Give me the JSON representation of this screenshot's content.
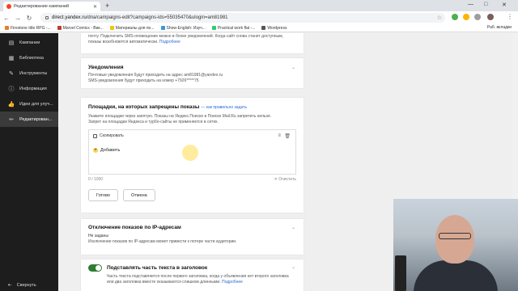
{
  "browser": {
    "tab_title": "Редактирование кампаний",
    "url_domain": "direct.yandex.ru",
    "url_path": "/dna/campaigns-edit?campaigns-ids=55035470&ulogin=am81981",
    "bookmarks": [
      "Firestone Idle RPG -...",
      "Marvel Comics - Вик...",
      "Материалы для по...",
      "Show-English: Изуч...",
      "Practical work flat -...",
      "Wordpress"
    ],
    "other_bookmarks": "Раб. вкладки"
  },
  "sidebar": {
    "items": [
      {
        "label": "Кампании",
        "icon": "document-icon"
      },
      {
        "label": "Библиотека",
        "icon": "library-icon"
      },
      {
        "label": "Инструменты",
        "icon": "wrench-icon"
      },
      {
        "label": "Информация",
        "icon": "info-icon"
      },
      {
        "label": "Идеи для улуч...",
        "icon": "thumbs-up-icon"
      },
      {
        "label": "Редактирован...",
        "icon": "pencil-icon"
      }
    ],
    "collapse_label": "Свернуть"
  },
  "top_card": {
    "text": "почту. Подключить SMS-оповещение можно в блоке уведомлений. Когда сайт снова станет доступным, показы возобновятся автоматически.",
    "link": "Подробнее"
  },
  "notifications": {
    "title": "Уведомления",
    "line1": "Почтовые уведомления будут приходить на адрес am81981@yandex.ru",
    "line2": "SMS-уведомления будут приходить на номер +7926*****75"
  },
  "placements": {
    "title": "Площадки, на которых запрещены показы",
    "hint_link": "— как правильно задать",
    "desc1": "Укажите площадки через запятую. Показы на Яндекс.Поиске и Поиске Mail.Ru запретить нельзя.",
    "desc2": "Запрет на площадки Яндекса и турбо-сайты не применяется в сетях.",
    "copy_label": "Скопировать",
    "add_label": "Добавить",
    "counter": "0 / 1000",
    "clear_label": "Очистить",
    "done_button": "Готово",
    "cancel_button": "Отмена"
  },
  "ip_block": {
    "title": "Отключение показов по IP-адресам",
    "value": "Не заданы",
    "note": "Исключение показов по IP-адресам может привести к потере части аудитории."
  },
  "substitute": {
    "title": "Подставлять часть текста в заголовок",
    "text": "Часть текста подставляется после первого заголовка, когда у объявления нет второго заголовка или два заголовка вместе оказываются слишком длинными.",
    "link": "Подробнее",
    "enabled": true
  },
  "colors": {
    "sidebar_bg": "#1d1d1d",
    "link": "#2d6ad6",
    "toggle_on": "#2e7d32"
  }
}
